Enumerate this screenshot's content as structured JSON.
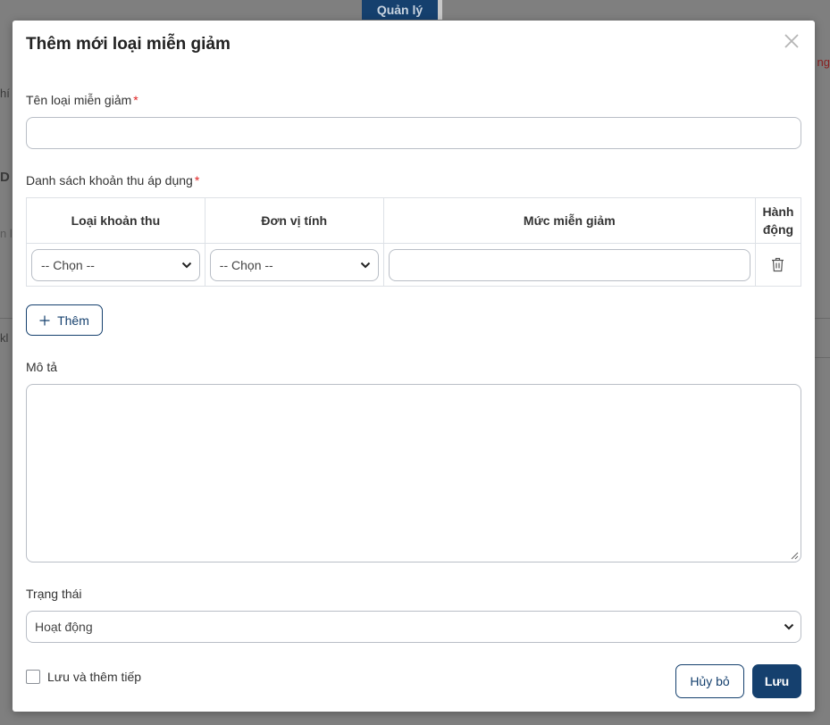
{
  "background": {
    "tab_label": "Quản lý",
    "left_fragments": [
      "hí",
      "D",
      "n l",
      "kl"
    ],
    "right_fragment": "ng"
  },
  "modal": {
    "title": "Thêm mới loại miễn giảm",
    "close_icon": "close-icon"
  },
  "form": {
    "name_label": "Tên loại miễn giảm",
    "required_mark": "*",
    "name_value": "",
    "fees_label": "Danh sách khoản thu áp dụng",
    "table": {
      "headers": [
        "Loại khoản thu",
        "Đơn vị tính",
        "Mức miễn giảm",
        "Hành động"
      ],
      "rows": [
        {
          "fee_type": "-- Chọn --",
          "unit": "-- Chọn --",
          "discount": "",
          "action_icon": "trash-icon"
        }
      ]
    },
    "add_button": "Thêm",
    "add_icon": "plus-icon",
    "desc_label": "Mô tả",
    "desc_value": "",
    "status_label": "Trạng thái",
    "status_value": "Hoạt động",
    "save_continue_label": "Lưu và thêm tiếp",
    "save_continue_checked": false
  },
  "footer": {
    "cancel": "Hủy bỏ",
    "save": "Lưu"
  },
  "colors": {
    "primary": "#15406e",
    "required": "#e02424",
    "overlay": "#7f7f7f"
  }
}
